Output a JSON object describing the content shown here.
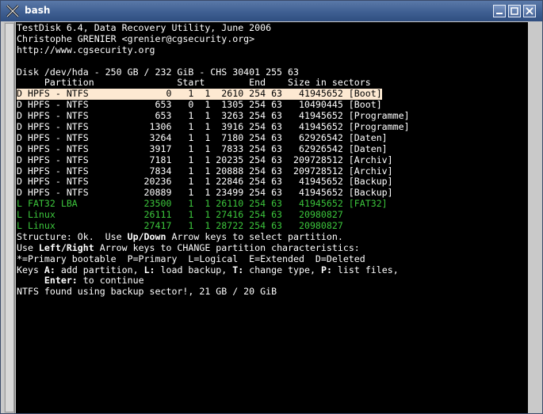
{
  "window": {
    "title": "bash"
  },
  "header": [
    "TestDisk 6.4, Data Recovery Utility, June 2006",
    "Christophe GRENIER <grenier@cgsecurity.org>",
    "http://www.cgsecurity.org"
  ],
  "disk_line": "Disk /dev/hda - 250 GB / 232 GiB - CHS 30401 255 63",
  "column_header": "     Partition               Start        End    Size in sectors",
  "partitions": [
    {
      "text": "D HPFS - NTFS              0   1  1  2610 254 63   41945652 [Boot]",
      "selected": true,
      "green": false
    },
    {
      "text": "D HPFS - NTFS            653   0  1  1305 254 63   10490445 [Boot]",
      "selected": false,
      "green": false
    },
    {
      "text": "D HPFS - NTFS            653   1  1  3263 254 63   41945652 [Programme]",
      "selected": false,
      "green": false
    },
    {
      "text": "D HPFS - NTFS           1306   1  1  3916 254 63   41945652 [Programme]",
      "selected": false,
      "green": false
    },
    {
      "text": "D HPFS - NTFS           3264   1  1  7180 254 63   62926542 [Daten]",
      "selected": false,
      "green": false
    },
    {
      "text": "D HPFS - NTFS           3917   1  1  7833 254 63   62926542 [Daten]",
      "selected": false,
      "green": false
    },
    {
      "text": "D HPFS - NTFS           7181   1  1 20235 254 63  209728512 [Archiv]",
      "selected": false,
      "green": false
    },
    {
      "text": "D HPFS - NTFS           7834   1  1 20888 254 63  209728512 [Archiv]",
      "selected": false,
      "green": false
    },
    {
      "text": "D HPFS - NTFS          20236   1  1 22846 254 63   41945652 [Backup]",
      "selected": false,
      "green": false
    },
    {
      "text": "D HPFS - NTFS          20889   1  1 23499 254 63   41945652 [Backup]",
      "selected": false,
      "green": false
    },
    {
      "text": "L FAT32 LBA            23500   1  1 26110 254 63   41945652 [FAT32]",
      "selected": false,
      "green": true
    },
    {
      "text": "L Linux                26111   1  1 27416 254 63   20980827",
      "selected": false,
      "green": true
    },
    {
      "text": "L Linux                27417   1  1 28722 254 63   20980827",
      "selected": false,
      "green": true
    }
  ],
  "help": {
    "structure_pre": "Structure: Ok.  Use ",
    "structure_keys": "Up/Down",
    "structure_post": " Arrow keys to select partition.",
    "use_pre": "Use ",
    "use_keys": "Left/Right",
    "use_post": " Arrow keys to CHANGE partition characteristics:",
    "legend": "*=Primary bootable  P=Primary  L=Logical  E=Extended  D=Deleted",
    "keys_pre": "Keys ",
    "key_a": "A:",
    "key_a_text": " add partition, ",
    "key_l": "L:",
    "key_l_text": " load backup, ",
    "key_t": "T:",
    "key_t_text": " change type, ",
    "key_p": "P:",
    "key_p_text": " list files,",
    "enter_indent": "     ",
    "enter_key": "Enter:",
    "enter_text": " to continue",
    "status": "NTFS found using backup sector!, 21 GB / 20 GiB"
  }
}
